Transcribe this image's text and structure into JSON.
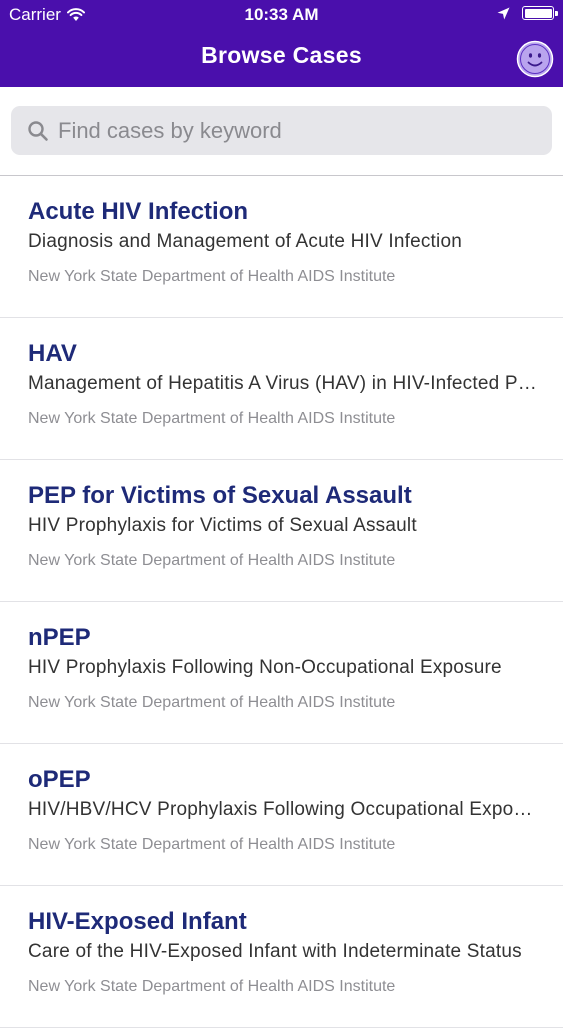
{
  "status_bar": {
    "carrier": "Carrier",
    "time": "10:33 AM"
  },
  "nav": {
    "title": "Browse Cases",
    "avatar_icon": "smiley-face-icon"
  },
  "search": {
    "placeholder": "Find cases by keyword"
  },
  "colors": {
    "header_bg": "#4a0fac",
    "title_text": "#1e2a78",
    "avatar_fill": "#b9a4ee"
  },
  "cases": [
    {
      "title": "Acute HIV Infection",
      "subtitle": "Diagnosis and Management of Acute HIV Infection",
      "source": "New York State Department of Health AIDS Institute"
    },
    {
      "title": "HAV",
      "subtitle": "Management of Hepatitis A Virus (HAV) in HIV-Infected Patients",
      "source": "New York State Department of Health AIDS Institute"
    },
    {
      "title": "PEP for Victims of Sexual Assault",
      "subtitle": "HIV Prophylaxis for Victims of Sexual Assault",
      "source": "New York State Department of Health AIDS Institute"
    },
    {
      "title": "nPEP",
      "subtitle": "HIV Prophylaxis Following Non-Occupational Exposure",
      "source": "New York State Department of Health AIDS Institute"
    },
    {
      "title": "oPEP",
      "subtitle": "HIV/HBV/HCV Prophylaxis Following Occupational Exposure",
      "source": "New York State Department of Health AIDS Institute"
    },
    {
      "title": "HIV-Exposed Infant",
      "subtitle": "Care of the HIV-Exposed Infant with Indeterminate Status",
      "source": "New York State Department of Health AIDS Institute"
    }
  ]
}
